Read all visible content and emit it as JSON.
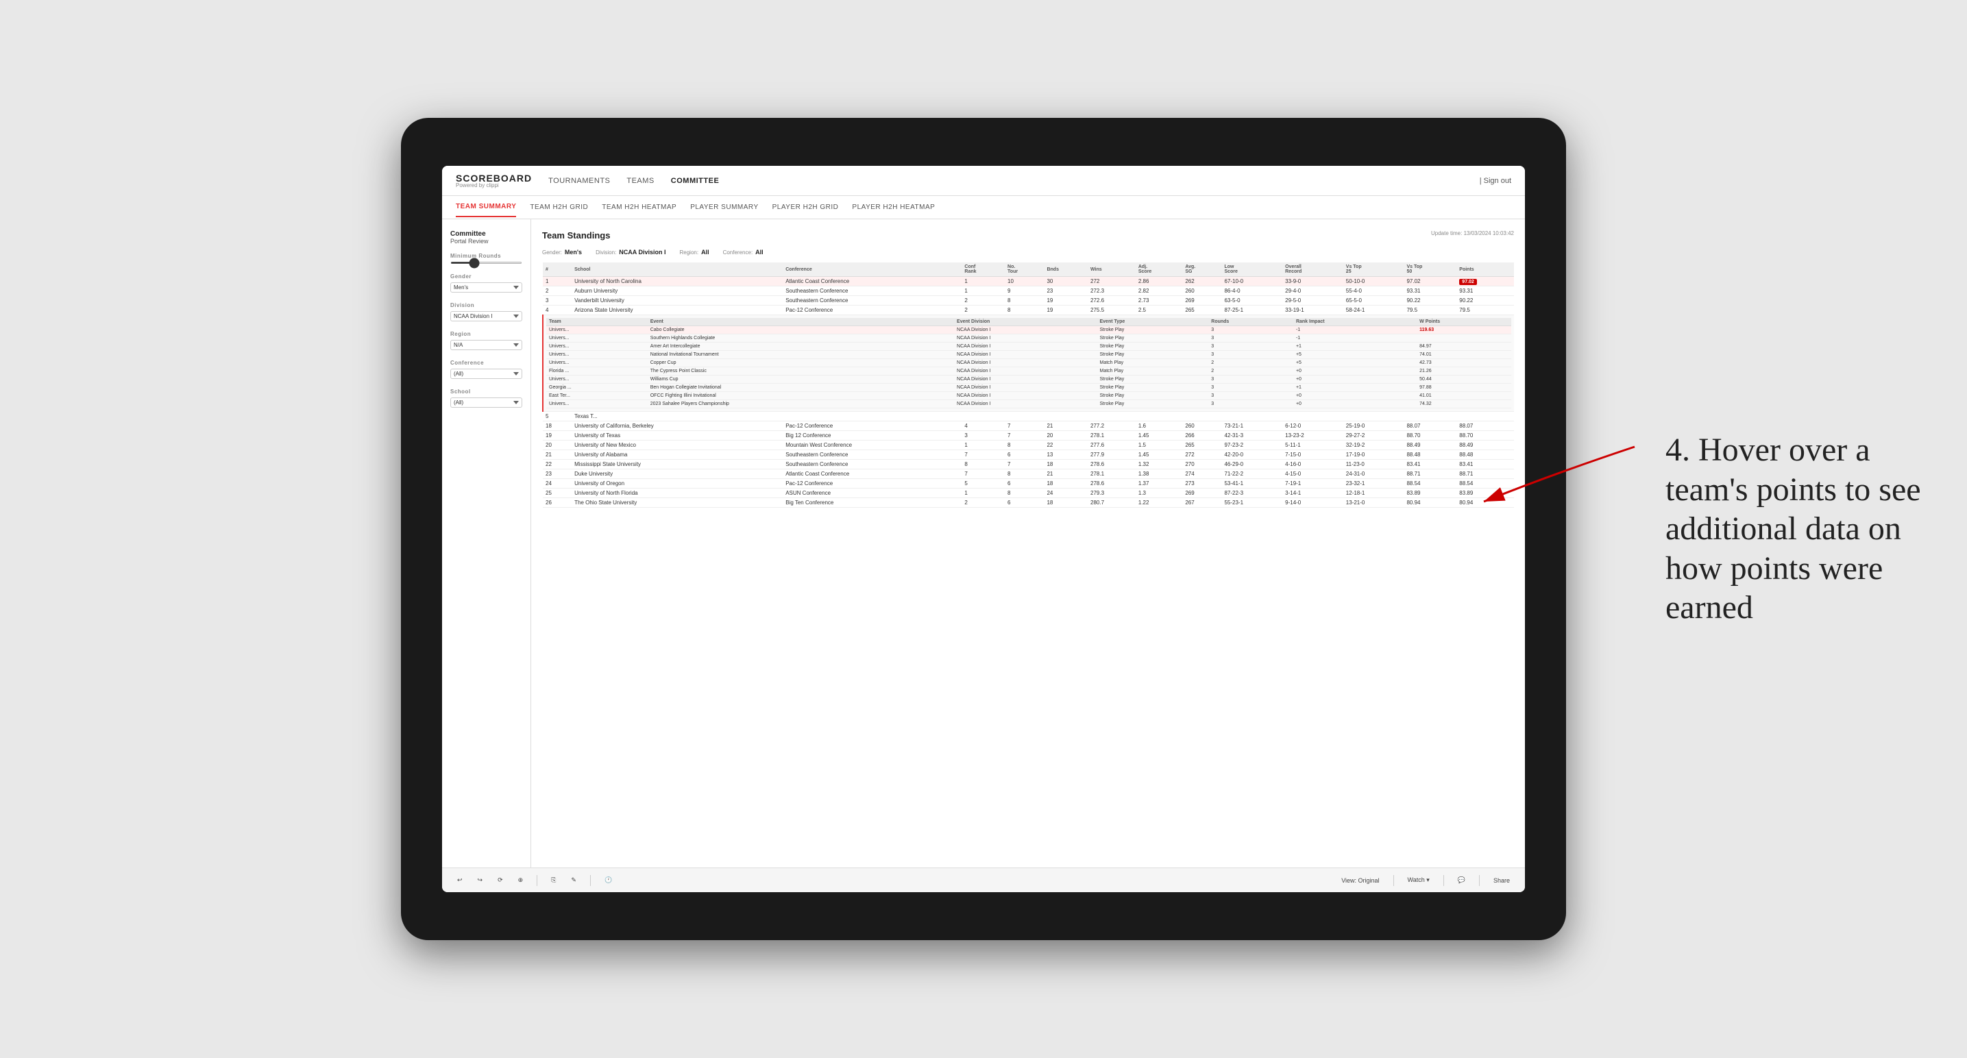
{
  "app": {
    "logo_main": "SCOREBOARD",
    "logo_sub": "Powered by clippi",
    "sign_out_label": "| Sign out"
  },
  "nav": {
    "items": [
      {
        "label": "TOURNAMENTS",
        "active": false
      },
      {
        "label": "TEAMS",
        "active": false
      },
      {
        "label": "COMMITTEE",
        "active": true
      }
    ]
  },
  "sub_nav": {
    "items": [
      {
        "label": "TEAM SUMMARY",
        "active": true
      },
      {
        "label": "TEAM H2H GRID",
        "active": false
      },
      {
        "label": "TEAM H2H HEATMAP",
        "active": false
      },
      {
        "label": "PLAYER SUMMARY",
        "active": false
      },
      {
        "label": "PLAYER H2H GRID",
        "active": false
      },
      {
        "label": "PLAYER H2H HEATMAP",
        "active": false
      }
    ]
  },
  "sidebar": {
    "committee_title": "Committee",
    "portal_review": "Portal Review",
    "sections": [
      {
        "label": "Minimum Rounds",
        "type": "slider"
      },
      {
        "label": "Gender",
        "type": "select",
        "value": "Men's"
      },
      {
        "label": "Division",
        "type": "select",
        "value": "NCAA Division I"
      },
      {
        "label": "Region",
        "type": "select",
        "value": "N/A"
      },
      {
        "label": "Conference",
        "type": "select",
        "value": "(All)"
      },
      {
        "label": "School",
        "type": "select",
        "value": "(All)"
      }
    ]
  },
  "panel": {
    "title": "Team Standings",
    "update_label": "Update time:",
    "update_time": "13/03/2024 10:03:42",
    "filters": {
      "gender_label": "Gender:",
      "gender_value": "Men's",
      "division_label": "Division:",
      "division_value": "NCAA Division I",
      "region_label": "Region:",
      "region_value": "All",
      "conference_label": "Conference:",
      "conference_value": "All"
    },
    "table_headers": [
      "#",
      "School",
      "Conference",
      "Conf Rank",
      "No. Tour",
      "Bnds",
      "Wins",
      "Adj. Score",
      "Avg. SG",
      "Low Score",
      "Overall Record",
      "Vs Top 25",
      "Vs Top 50",
      "Points"
    ],
    "rows": [
      {
        "rank": 1,
        "school": "University of North Carolina",
        "conference": "Atlantic Coast Conference",
        "conf_rank": 1,
        "tours": 10,
        "bnds": 30,
        "wins": 272.0,
        "adj": 2.86,
        "avg_sg": 262,
        "low_score": "67-10-0",
        "overall": "33-9-0",
        "vs25": "50-10-0",
        "vs50": "97.02",
        "points": "97.02",
        "highlight": true
      },
      {
        "rank": 2,
        "school": "Auburn University",
        "conference": "Southeastern Conference",
        "conf_rank": 1,
        "tours": 9,
        "bnds": 23,
        "wins": 272.3,
        "adj": 2.82,
        "avg_sg": 260,
        "low_score": "86-4-0",
        "overall": "29-4-0",
        "vs25": "55-4-0",
        "vs50": "93.31",
        "points": "93.31",
        "highlight": false
      },
      {
        "rank": 3,
        "school": "Vanderbilt University",
        "conference": "Southeastern Conference",
        "conf_rank": 2,
        "tours": 8,
        "bnds": 19,
        "wins": 272.6,
        "adj": 2.73,
        "avg_sg": 269,
        "low_score": "63-5-0",
        "overall": "29-5-0",
        "vs25": "65-5-0",
        "vs50": "90.22",
        "points": "90.22",
        "highlight": false
      },
      {
        "rank": 4,
        "school": "Arizona State University",
        "conference": "Pac-12 Conference",
        "conf_rank": 2,
        "tours": 8,
        "bnds": 19,
        "wins": 275.5,
        "adj": 2.5,
        "avg_sg": 265,
        "low_score": "87-25-1",
        "overall": "33-19-1",
        "vs25": "58-24-1",
        "vs50": "79.5",
        "points": "79.5",
        "tooltip": true
      },
      {
        "rank": 5,
        "school": "Texas T...",
        "conference": "",
        "conf_rank": "",
        "tours": "",
        "bnds": "",
        "wins": "",
        "adj": "",
        "avg_sg": "",
        "low_score": "",
        "overall": "",
        "vs25": "",
        "vs50": "",
        "points": ""
      },
      {
        "rank": 18,
        "school": "University of California, Berkeley",
        "conference": "Pac-12 Conference",
        "conf_rank": 4,
        "tours": 7,
        "bnds": 21,
        "wins": 277.2,
        "adj": 1.6,
        "avg_sg": 260,
        "low_score": "73-21-1",
        "overall": "6-12-0",
        "vs25": "25-19-0",
        "vs50": "88.07",
        "points": "88.07"
      },
      {
        "rank": 19,
        "school": "University of Texas",
        "conference": "Big 12 Conference",
        "conf_rank": 3,
        "tours": 7,
        "bnds": 20,
        "wins": 278.1,
        "adj": 1.45,
        "avg_sg": 266,
        "low_score": "42-31-3",
        "overall": "13-23-2",
        "vs25": "29-27-2",
        "vs50": "88.70",
        "points": "88.70"
      },
      {
        "rank": 20,
        "school": "University of New Mexico",
        "conference": "Mountain West Conference",
        "conf_rank": 1,
        "tours": 8,
        "bnds": 22,
        "wins": 277.6,
        "adj": 1.5,
        "avg_sg": 265,
        "low_score": "97-23-2",
        "overall": "5-11-1",
        "vs25": "32-19-2",
        "vs50": "88.49",
        "points": "88.49"
      },
      {
        "rank": 21,
        "school": "University of Alabama",
        "conference": "Southeastern Conference",
        "conf_rank": 7,
        "tours": 6,
        "bnds": 13,
        "wins": 277.9,
        "adj": 1.45,
        "avg_sg": 272,
        "low_score": "42-20-0",
        "overall": "7-15-0",
        "vs25": "17-19-0",
        "vs50": "88.48",
        "points": "88.48"
      },
      {
        "rank": 22,
        "school": "Mississippi State University",
        "conference": "Southeastern Conference",
        "conf_rank": 8,
        "tours": 7,
        "bnds": 18,
        "wins": 278.6,
        "adj": 1.32,
        "avg_sg": 270,
        "low_score": "46-29-0",
        "overall": "4-16-0",
        "vs25": "11-23-0",
        "vs50": "83.41",
        "points": "83.41"
      },
      {
        "rank": 23,
        "school": "Duke University",
        "conference": "Atlantic Coast Conference",
        "conf_rank": 7,
        "tours": 8,
        "bnds": 21,
        "wins": 278.1,
        "adj": 1.38,
        "avg_sg": 274,
        "low_score": "71-22-2",
        "overall": "4-15-0",
        "vs25": "24-31-0",
        "vs50": "88.71",
        "points": "88.71"
      },
      {
        "rank": 24,
        "school": "University of Oregon",
        "conference": "Pac-12 Conference",
        "conf_rank": 5,
        "tours": 6,
        "bnds": 18,
        "wins": 278.6,
        "adj": 1.37,
        "avg_sg": 273,
        "low_score": "53-41-1",
        "overall": "7-19-1",
        "vs25": "23-32-1",
        "vs50": "88.54",
        "points": "88.54"
      },
      {
        "rank": 25,
        "school": "University of North Florida",
        "conference": "ASUN Conference",
        "conf_rank": 1,
        "tours": 8,
        "bnds": 24,
        "wins": 279.3,
        "adj": 1.3,
        "avg_sg": 269,
        "low_score": "87-22-3",
        "overall": "3-14-1",
        "vs25": "12-18-1",
        "vs50": "83.89",
        "points": "83.89"
      },
      {
        "rank": 26,
        "school": "The Ohio State University",
        "conference": "Big Ten Conference",
        "conf_rank": 2,
        "tours": 6,
        "bnds": 18,
        "wins": 280.7,
        "adj": 1.22,
        "avg_sg": 267,
        "low_score": "55-23-1",
        "overall": "9-14-0",
        "vs25": "13-21-0",
        "vs50": "80.94",
        "points": "80.94"
      }
    ],
    "tooltip_rows": [
      {
        "team": "Univers...",
        "event": "Cabo Collegiate",
        "event_division": "NCAA Division I",
        "event_type": "Stroke Play",
        "rounds": 3,
        "rank_impact": -1,
        "w_points": "119.63",
        "highlight": true
      },
      {
        "team": "Univers...",
        "event": "Southern Highlands Collegiate",
        "event_division": "NCAA Division I",
        "event_type": "Stroke Play",
        "rounds": 3,
        "rank_impact": -1,
        "w_points": ""
      },
      {
        "team": "Univers...",
        "event": "Amer Art Intercollegiate",
        "event_division": "NCAA Division I",
        "event_type": "Stroke Play",
        "rounds": 3,
        "rank_impact": "+1",
        "w_points": "84.97"
      },
      {
        "team": "Univers...",
        "event": "National Invitational Tournament",
        "event_division": "NCAA Division I",
        "event_type": "Stroke Play",
        "rounds": 3,
        "rank_impact": "+5",
        "w_points": "74.01"
      },
      {
        "team": "Univers...",
        "event": "Copper Cup",
        "event_division": "NCAA Division I",
        "event_type": "Match Play",
        "rounds": 2,
        "rank_impact": "+5",
        "w_points": "42.73"
      },
      {
        "team": "Florida ...",
        "event": "The Cypress Point Classic",
        "event_division": "NCAA Division I",
        "event_type": "Match Play",
        "rounds": 2,
        "rank_impact": "+0",
        "w_points": "21.26"
      },
      {
        "team": "Univers...",
        "event": "Williams Cup",
        "event_division": "NCAA Division I",
        "event_type": "Stroke Play",
        "rounds": 3,
        "rank_impact": "+0",
        "w_points": "50.44"
      },
      {
        "team": "Georgia ...",
        "event": "Ben Hogan Collegiate Invitational",
        "event_division": "NCAA Division I",
        "event_type": "Stroke Play",
        "rounds": 3,
        "rank_impact": "+1",
        "w_points": "97.88"
      },
      {
        "team": "East Ter...",
        "event": "OFCC Fighting Illini Invitational",
        "event_division": "NCAA Division I",
        "event_type": "Stroke Play",
        "rounds": 3,
        "rank_impact": "+0",
        "w_points": "41.01"
      },
      {
        "team": "Univers...",
        "event": "2023 Sahalee Players Championship",
        "event_division": "NCAA Division I",
        "event_type": "Stroke Play",
        "rounds": 3,
        "rank_impact": "+0",
        "w_points": "74.32"
      }
    ],
    "tooltip_headers": [
      "Team",
      "Event",
      "Event Division",
      "Event Type",
      "Rounds",
      "Rank Impact",
      "W Points"
    ]
  },
  "toolbar": {
    "undo_label": "↩",
    "redo_label": "↪",
    "refresh_label": "⟳",
    "zoom_label": "⊕",
    "copy_label": "⎘",
    "pencil_label": "✎",
    "clock_label": "🕐",
    "view_label": "View: Original",
    "watch_label": "Watch ▾",
    "share_label": "Share",
    "comment_label": "💬"
  },
  "annotation": {
    "text": "4. Hover over a team's points to see additional data on how points were earned"
  }
}
